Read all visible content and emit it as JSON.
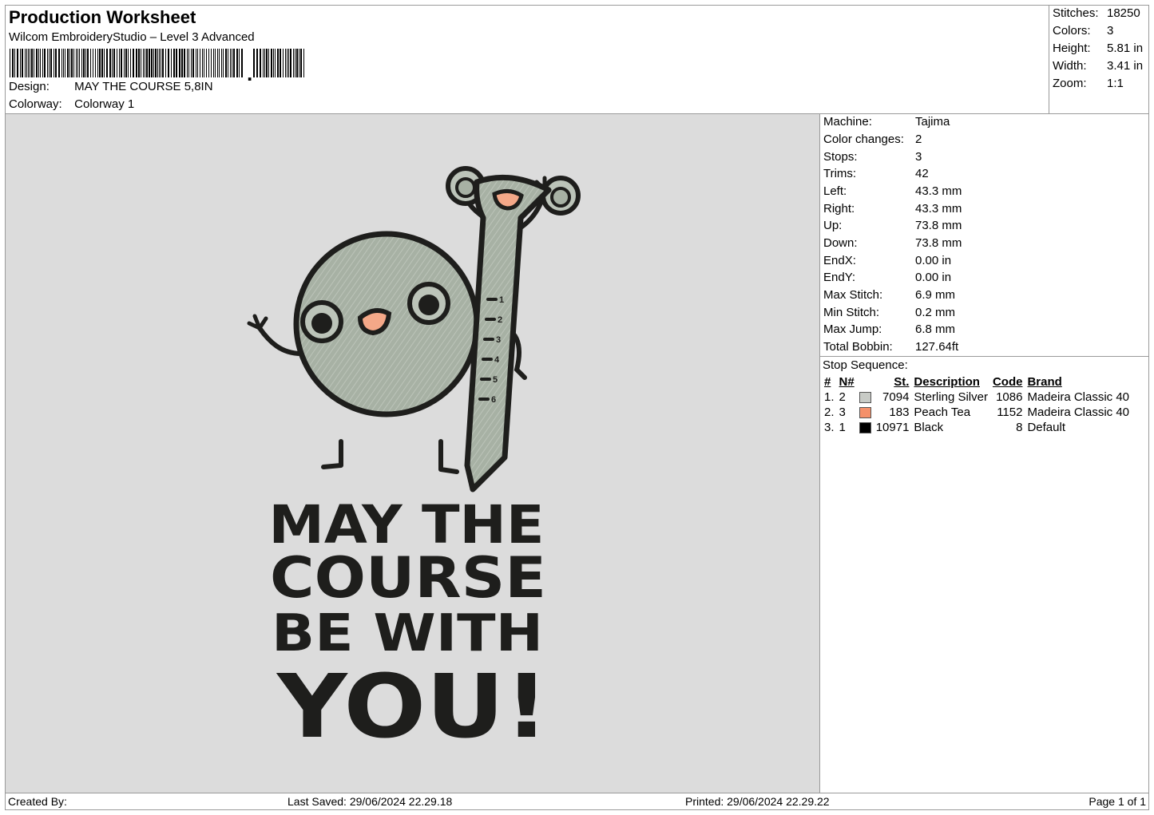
{
  "header": {
    "title": "Production Worksheet",
    "subtitle": "Wilcom EmbroideryStudio – Level 3 Advanced",
    "design_label": "Design:",
    "design_value": "MAY THE COURSE 5,8IN",
    "colorway_label": "Colorway:",
    "colorway_value": "Colorway 1"
  },
  "summary": [
    {
      "label": "Stitches:",
      "value": "18250"
    },
    {
      "label": "Colors:",
      "value": "3"
    },
    {
      "label": "Height:",
      "value": "5.81 in"
    },
    {
      "label": "Width:",
      "value": "3.41 in"
    },
    {
      "label": "Zoom:",
      "value": "1:1"
    }
  ],
  "details": [
    {
      "label": "Machine:",
      "value": "Tajima"
    },
    {
      "label": "Color changes:",
      "value": "2"
    },
    {
      "label": "Stops:",
      "value": "3"
    },
    {
      "label": "Trims:",
      "value": "42"
    },
    {
      "label": "Left:",
      "value": "43.3 mm"
    },
    {
      "label": "Right:",
      "value": "43.3 mm"
    },
    {
      "label": "Up:",
      "value": "73.8 mm"
    },
    {
      "label": "Down:",
      "value": "73.8 mm"
    },
    {
      "label": "EndX:",
      "value": "0.00 in"
    },
    {
      "label": "EndY:",
      "value": "0.00 in"
    },
    {
      "label": "Max Stitch:",
      "value": "6.9 mm"
    },
    {
      "label": "Min Stitch:",
      "value": "0.2 mm"
    },
    {
      "label": "Max Jump:",
      "value": "6.8 mm"
    },
    {
      "label": "Total Bobbin:",
      "value": "127.64ft"
    }
  ],
  "stop_sequence": {
    "title": "Stop Sequence:",
    "headers": {
      "num": "#",
      "n": "N#",
      "st": "St.",
      "desc": "Description",
      "code": "Code",
      "brand": "Brand"
    },
    "rows": [
      {
        "num": "1.",
        "n": "2",
        "color": "#c8cbc6",
        "st": "7094",
        "desc": "Sterling Silver",
        "code": "1086",
        "brand": "Madeira Classic 40"
      },
      {
        "num": "2.",
        "n": "3",
        "color": "#f4906a",
        "st": "183",
        "desc": "Peach Tea",
        "code": "1152",
        "brand": "Madeira Classic 40"
      },
      {
        "num": "3.",
        "n": "1",
        "color": "#000000",
        "st": "10971",
        "desc": "Black",
        "code": "8",
        "brand": "Default"
      }
    ]
  },
  "design_text": [
    "MAY THE",
    "COURSE",
    "BE WITH",
    "YOU!"
  ],
  "ruler_marks": [
    "1",
    "2",
    "3",
    "4",
    "5",
    "6"
  ],
  "barcode_text": ",",
  "colors": {
    "fill": "#a7b1a4",
    "outline": "#1e1e1c",
    "accent": "#f4a888",
    "background": "#dcdcdc"
  },
  "footer": {
    "created_by": "Created By:",
    "last_saved": "Last Saved: 29/06/2024 22.29.18",
    "printed": "Printed: 29/06/2024 22.29.22",
    "page": "Page 1 of 1"
  }
}
